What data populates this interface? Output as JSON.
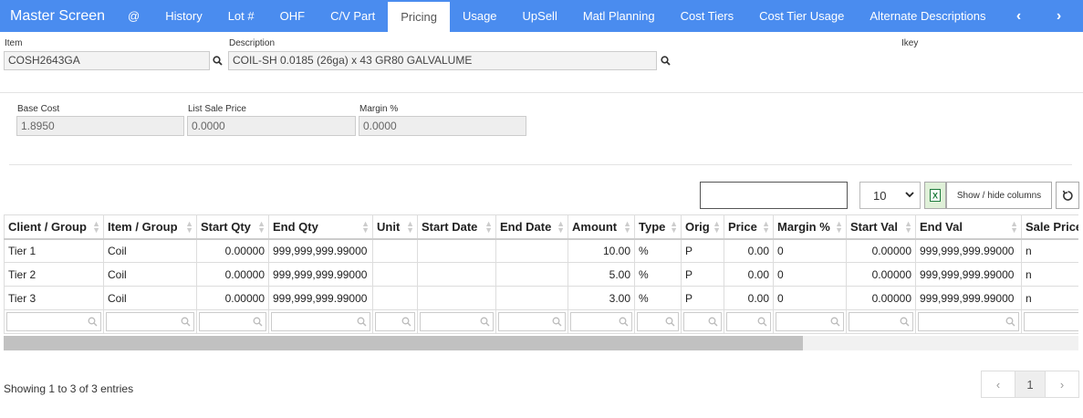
{
  "nav": {
    "brand": "Master Screen",
    "items": [
      "@",
      "History",
      "Lot #",
      "OHF",
      "C/V Part",
      "Pricing",
      "Usage",
      "UpSell",
      "Matl Planning",
      "Cost Tiers",
      "Cost Tier Usage",
      "Alternate Descriptions"
    ],
    "active": "Pricing",
    "prev": "‹",
    "next": "›"
  },
  "item": {
    "item_label": "Item",
    "item_value": "COSH2643GA",
    "desc_label": "Description",
    "desc_value": "COIL-SH 0.0185 (26ga) x 43 GR80 GALVALUME",
    "ikey_label": "Ikey"
  },
  "cost": {
    "base_label": "Base Cost",
    "base_value": "1.8950",
    "list_label": "List Sale Price",
    "list_value": "0.0000",
    "margin_label": "Margin %",
    "margin_value": "0.0000"
  },
  "controls": {
    "page_size": "10",
    "show_hide": "Show / hide columns"
  },
  "table": {
    "columns": [
      "Client / Group",
      "Item / Group",
      "Start Qty",
      "End Qty",
      "Unit",
      "Start Date",
      "End Date",
      "Amount",
      "Type",
      "Orig",
      "Price",
      "Margin %",
      "Start Val",
      "End Val",
      "Sale Price"
    ],
    "rows": [
      [
        "Tier 1",
        "Coil",
        "0.00000",
        "999,999,999.99000",
        "",
        "",
        "",
        "10.00",
        "%",
        "P",
        "0.00",
        "0",
        "0.00000",
        "999,999,999.99000",
        "n"
      ],
      [
        "Tier 2",
        "Coil",
        "0.00000",
        "999,999,999.99000",
        "",
        "",
        "",
        "5.00",
        "%",
        "P",
        "0.00",
        "0",
        "0.00000",
        "999,999,999.99000",
        "n"
      ],
      [
        "Tier 3",
        "Coil",
        "0.00000",
        "999,999,999.99000",
        "",
        "",
        "",
        "3.00",
        "%",
        "P",
        "0.00",
        "0",
        "0.00000",
        "999,999,999.99000",
        "n"
      ]
    ]
  },
  "footer": {
    "entries": "Showing 1 to 3 of 3 entries",
    "page": "1"
  }
}
